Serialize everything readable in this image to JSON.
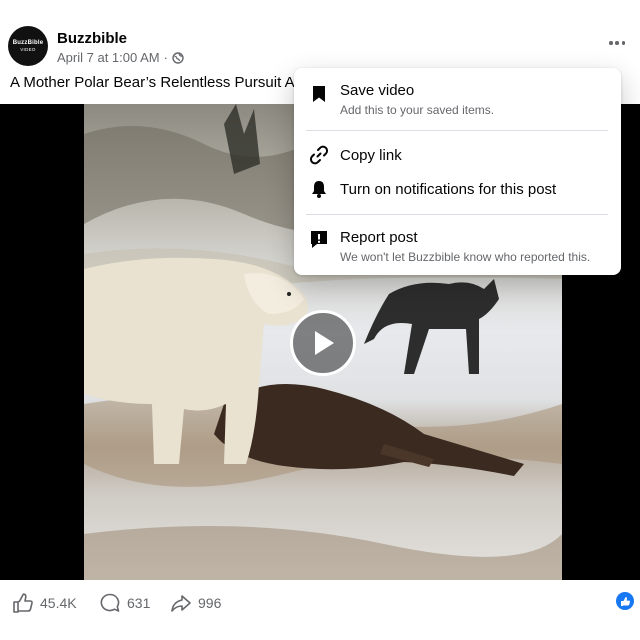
{
  "post": {
    "page_name": "Buzzbible",
    "avatar_text_line1": "BuzzBible",
    "avatar_text_line2": "VIDEO",
    "date": "April 7 at 1:00 AM",
    "separator": "·",
    "caption": "A Mother Polar Bear’s Relentless Pursuit Aft"
  },
  "menu": {
    "items": [
      {
        "title": "Save video",
        "subtitle": "Add this to your saved items.",
        "icon": "bookmark-icon"
      },
      {
        "title": "Copy link",
        "icon": "link-icon"
      },
      {
        "title": "Turn on notifications for this post",
        "icon": "bell-icon"
      },
      {
        "title": "Report post",
        "subtitle": "We won't let Buzzbible know who reported this.",
        "icon": "report-icon"
      }
    ]
  },
  "stats": {
    "likes": "45.4K",
    "comments": "631",
    "shares": "996"
  },
  "colors": {
    "brand_blue": "#1877f2",
    "secondary_text": "#65676b"
  }
}
